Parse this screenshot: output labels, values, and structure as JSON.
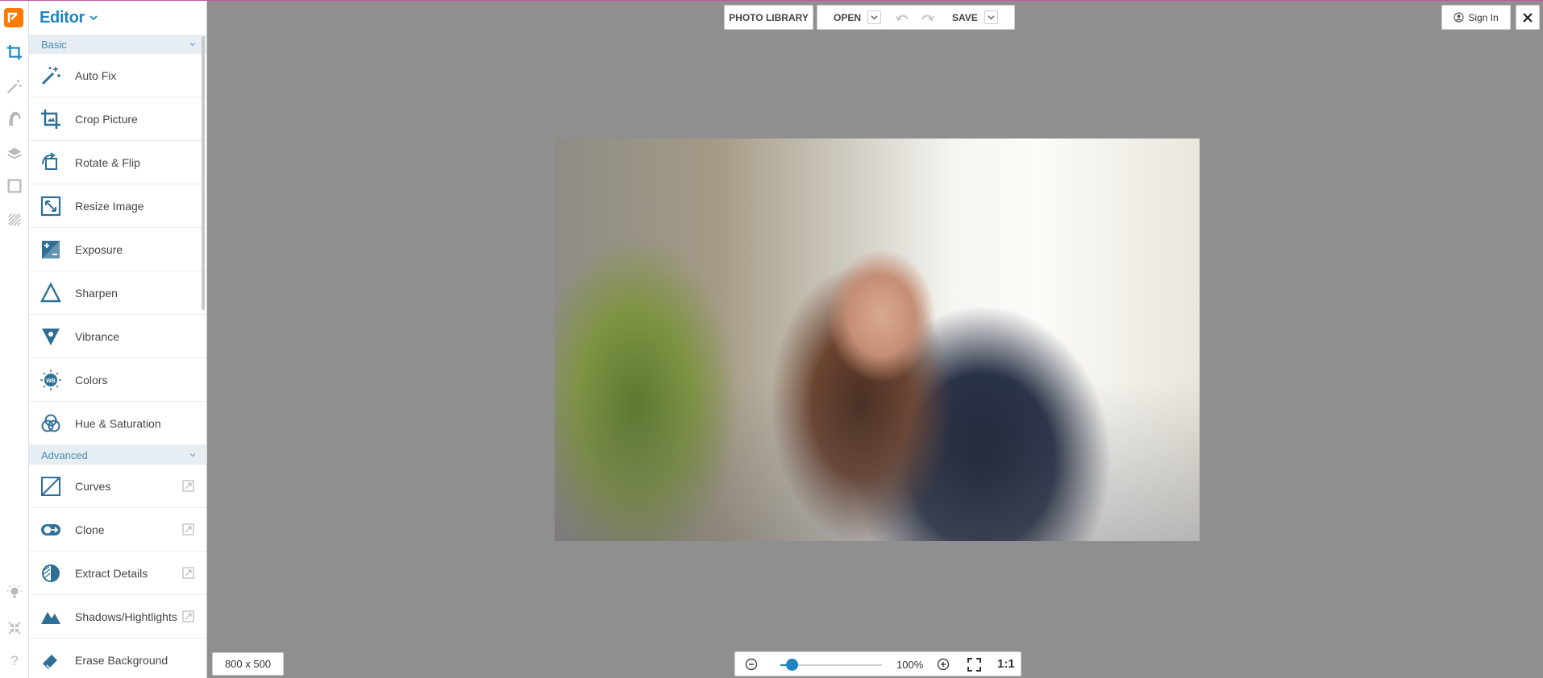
{
  "panel": {
    "title": "Editor",
    "sections": [
      {
        "name": "Basic"
      },
      {
        "name": "Advanced"
      }
    ],
    "basic_items": [
      "Auto Fix",
      "Crop Picture",
      "Rotate & Flip",
      "Resize Image",
      "Exposure",
      "Sharpen",
      "Vibrance",
      "Colors",
      "Hue & Saturation"
    ],
    "advanced_items": [
      "Curves",
      "Clone",
      "Extract Details",
      "Shadows/Hightlights",
      "Erase Background"
    ]
  },
  "toolbar": {
    "library_label": "PHOTO LIBRARY",
    "open_label": "OPEN",
    "save_label": "SAVE",
    "signin_label": "Sign In"
  },
  "status": {
    "dimensions": "800 x 500",
    "zoom_percent": "100%",
    "zoom_value": 0.11,
    "actual_size_label": "1:1"
  },
  "colors": {
    "accent": "#1f85c0",
    "logo": "#ff7a00",
    "canvas_bg": "#8f8f8f"
  },
  "icons": {
    "rail": [
      "app-logo-icon",
      "crop-tool-icon",
      "magic-wand-icon",
      "portrait-icon",
      "layers-icon",
      "frame-icon",
      "texture-icon",
      "lightbulb-icon",
      "fullscreen-exit-icon",
      "help-icon"
    ]
  }
}
